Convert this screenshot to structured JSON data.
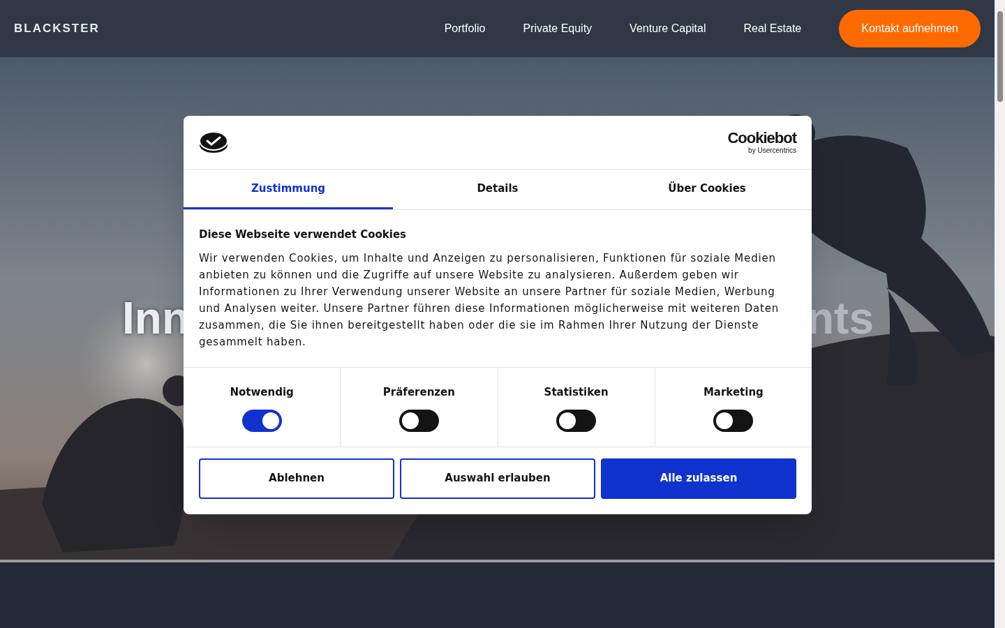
{
  "header": {
    "logo": "BLACKSTER",
    "nav": [
      "Portfolio",
      "Private Equity",
      "Venture Capital",
      "Real Estate"
    ],
    "cta": "Kontakt aufnehmen"
  },
  "hero": {
    "title_left": "Inn",
    "title_right": "nts"
  },
  "cookie_dialog": {
    "brand": "Cookiebot",
    "brand_sub": "by Usercentrics",
    "tabs": [
      {
        "label": "Zustimmung",
        "selected": true
      },
      {
        "label": "Details",
        "selected": false
      },
      {
        "label": "Über Cookies",
        "selected": false
      }
    ],
    "heading": "Diese Webseite verwendet Cookies",
    "body": "Wir verwenden Cookies, um Inhalte und Anzeigen zu personalisieren, Funktionen für soziale Medien anbieten zu können und die Zugriffe auf unsere Website zu analysieren. Außerdem geben wir Informationen zu Ihrer Verwendung unserer Website an unsere Partner für soziale Medien, Werbung und Analysen weiter. Unsere Partner führen diese Informationen möglicherweise mit weiteren Daten zusammen, die Sie ihnen bereitgestellt haben oder die sie im Rahmen Ihrer Nutzung der Dienste gesammelt haben.",
    "categories": [
      {
        "label": "Notwendig",
        "on": true
      },
      {
        "label": "Präferenzen",
        "on": false
      },
      {
        "label": "Statistiken",
        "on": false
      },
      {
        "label": "Marketing",
        "on": false
      }
    ],
    "buttons": [
      {
        "label": "Ablehnen",
        "kind": "outline"
      },
      {
        "label": "Auswahl erlauben",
        "kind": "outline"
      },
      {
        "label": "Alle zulassen",
        "kind": "primary"
      }
    ]
  }
}
